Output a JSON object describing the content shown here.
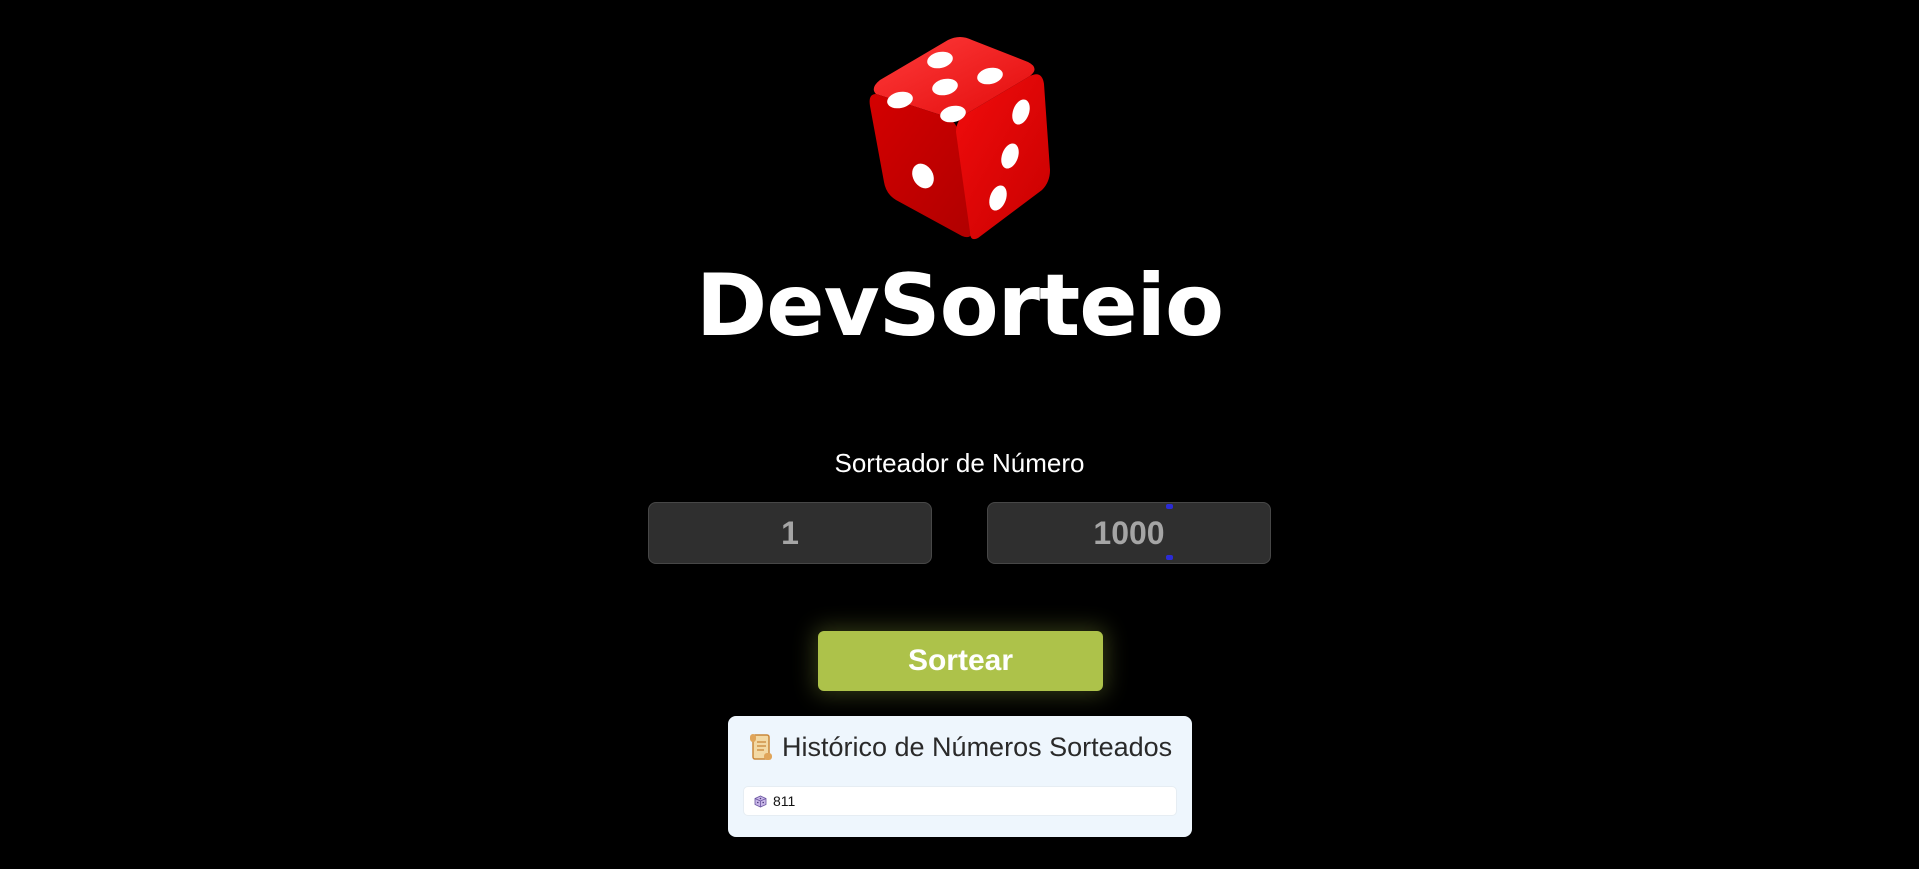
{
  "brand": {
    "title": "DevSorteio",
    "logo_icon": "red-dice-icon",
    "accent_color": "#e00000"
  },
  "generator": {
    "section_label": "Sorteador de Número",
    "min_value": "1",
    "max_value": "1000",
    "button_label": "Sortear",
    "button_color": "#adc24a"
  },
  "history": {
    "title_icon": "scroll-icon",
    "title": "Histórico de Números Sorteados",
    "items": [
      {
        "icon": "dice-icon",
        "value": "811"
      }
    ]
  }
}
